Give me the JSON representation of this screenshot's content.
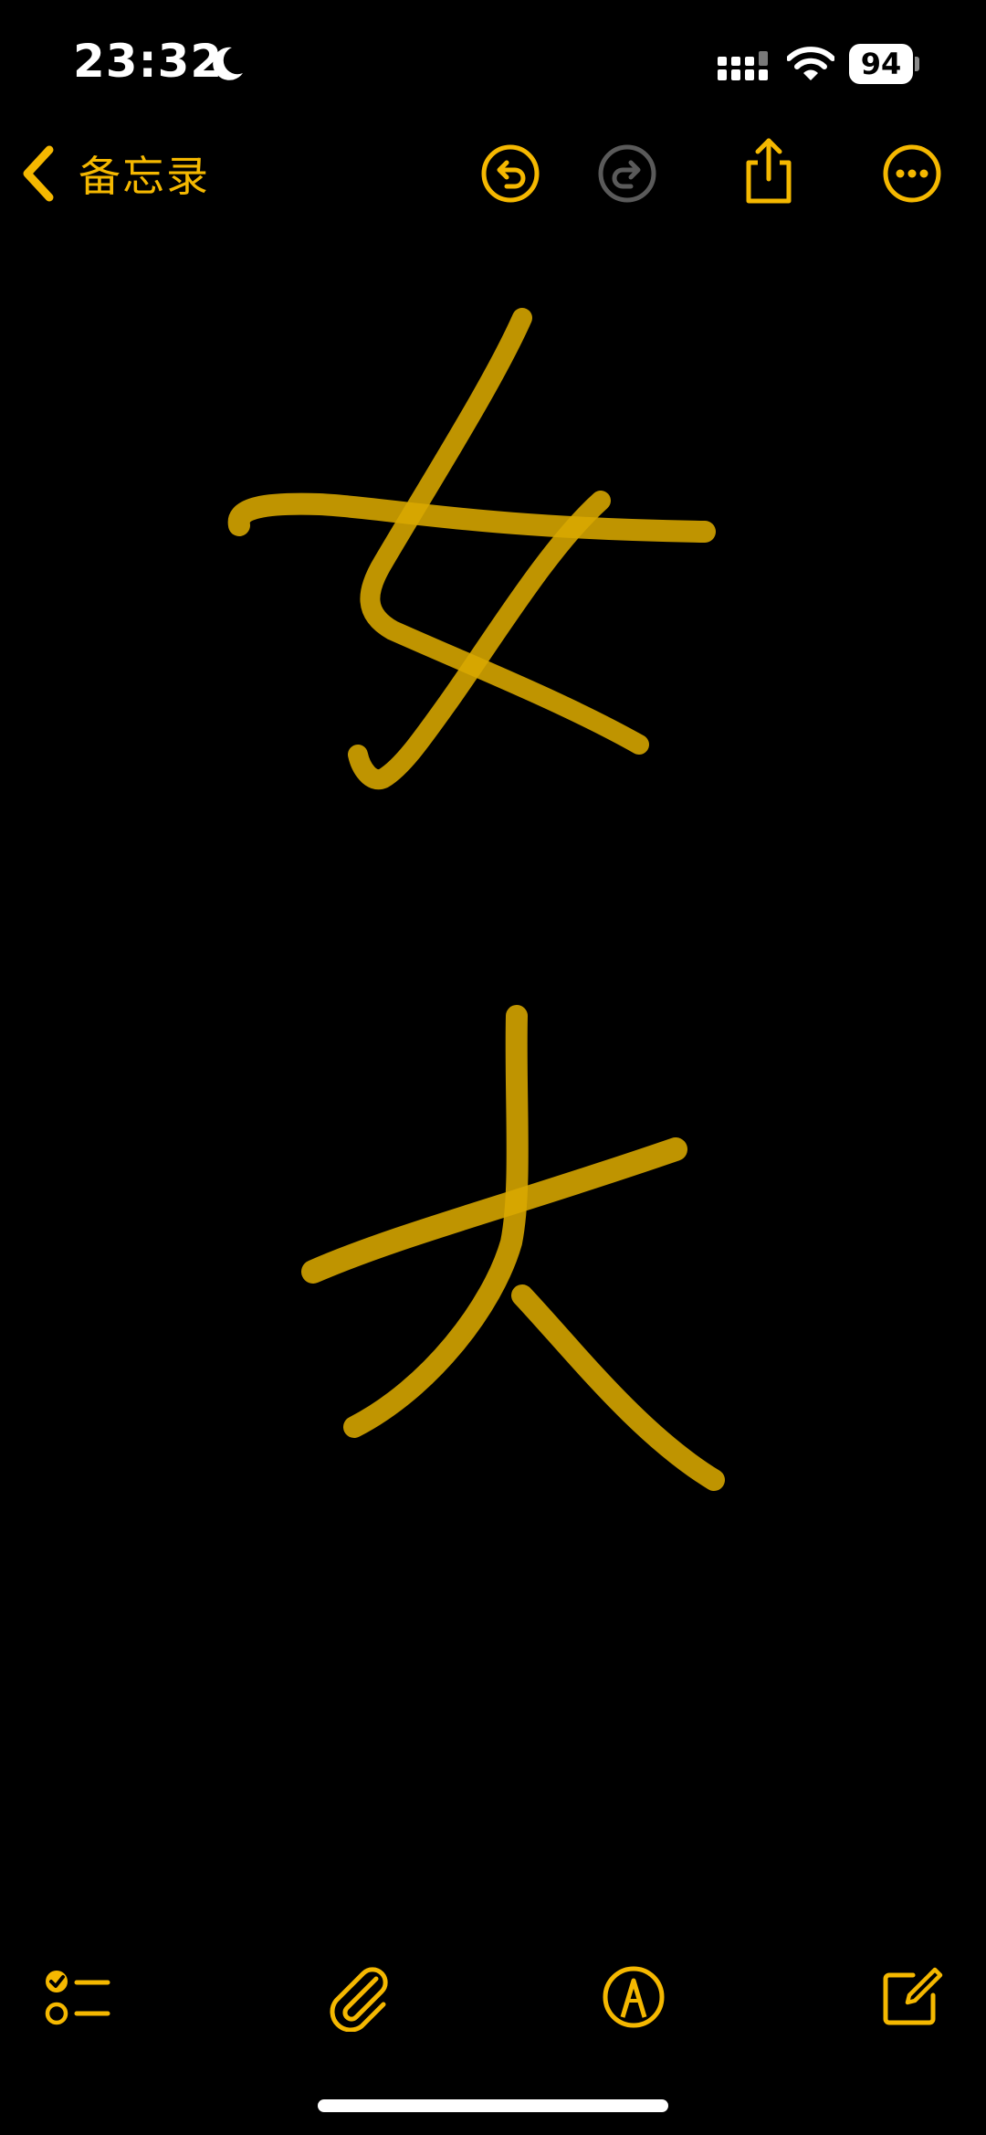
{
  "status_bar": {
    "time": "23:32",
    "battery": "94"
  },
  "nav": {
    "back_label": "备忘录"
  },
  "icons": {
    "moon": "moon-icon",
    "signal": "cellular-signal-icon",
    "wifi": "wifi-icon",
    "battery": "battery-icon",
    "back": "chevron-left-icon",
    "undo": "undo-icon",
    "redo": "redo-icon",
    "share": "share-icon",
    "more": "more-options-icon",
    "checklist": "checklist-icon",
    "attach": "paperclip-icon",
    "markup": "markup-pen-icon",
    "compose": "compose-icon"
  },
  "colors": {
    "accent": "#f5b800",
    "ink": "#d9a800",
    "disabled": "#5a5a5a",
    "background": "#000000"
  }
}
